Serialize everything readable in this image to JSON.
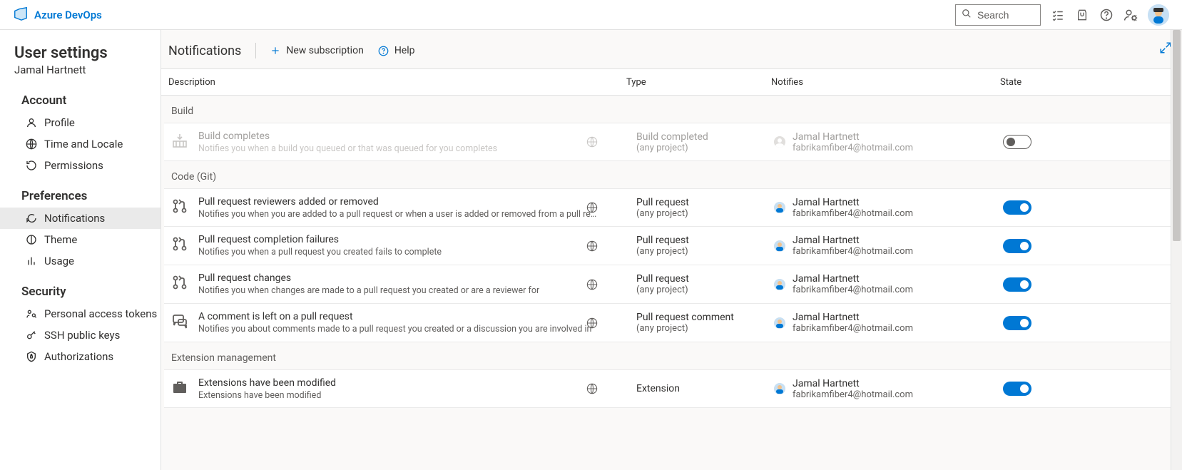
{
  "brand": "Azure DevOps",
  "search": {
    "placeholder": "Search"
  },
  "sidebar": {
    "page_title": "User settings",
    "user_name": "Jamal Hartnett",
    "sections": {
      "account": {
        "label": "Account",
        "items": [
          {
            "label": "Profile"
          },
          {
            "label": "Time and Locale"
          },
          {
            "label": "Permissions"
          }
        ]
      },
      "preferences": {
        "label": "Preferences",
        "items": [
          {
            "label": "Notifications"
          },
          {
            "label": "Theme"
          },
          {
            "label": "Usage"
          }
        ]
      },
      "security": {
        "label": "Security",
        "items": [
          {
            "label": "Personal access tokens"
          },
          {
            "label": "SSH public keys"
          },
          {
            "label": "Authorizations"
          }
        ]
      }
    }
  },
  "header": {
    "title": "Notifications",
    "new_subscription": "New subscription",
    "help": "Help"
  },
  "columns": {
    "description": "Description",
    "type": "Type",
    "notifies": "Notifies",
    "state": "State"
  },
  "person": {
    "name": "Jamal Hartnett",
    "email": "fabrikamfiber4@hotmail.com"
  },
  "groups": {
    "build": {
      "label": "Build",
      "rows": [
        {
          "title": "Build completes",
          "sub": "Notifies you when a build you queued or that was queued for you completes",
          "type_main": "Build completed",
          "type_sub": "(any project)",
          "state": "off",
          "disabled": true
        }
      ]
    },
    "code": {
      "label": "Code (Git)",
      "rows": [
        {
          "title": "Pull request reviewers added or removed",
          "sub": "Notifies you when you are added to a pull request or when a user is added or removed from a pull request you created",
          "type_main": "Pull request",
          "type_sub": "(any project)",
          "state": "on"
        },
        {
          "title": "Pull request completion failures",
          "sub": "Notifies you when a pull request you created fails to complete",
          "type_main": "Pull request",
          "type_sub": "(any project)",
          "state": "on"
        },
        {
          "title": "Pull request changes",
          "sub": "Notifies you when changes are made to a pull request you created or are a reviewer for",
          "type_main": "Pull request",
          "type_sub": "(any project)",
          "state": "on"
        },
        {
          "title": "A comment is left on a pull request",
          "sub": "Notifies you about comments made to a pull request you created or a discussion you are involved in",
          "type_main": "Pull request comment",
          "type_sub": "(any project)",
          "state": "on"
        }
      ]
    },
    "ext": {
      "label": "Extension management",
      "rows": [
        {
          "title": "Extensions have been modified",
          "sub": "Extensions have been modified",
          "type_main": "Extension",
          "type_sub": "",
          "state": "on"
        }
      ]
    }
  }
}
